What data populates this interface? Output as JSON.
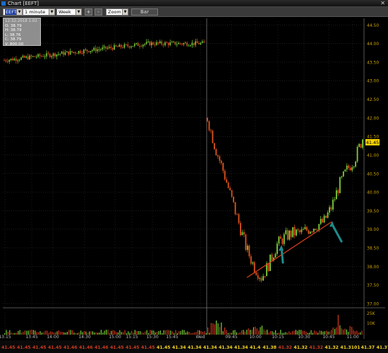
{
  "window": {
    "title": "Chart [EEFT]"
  },
  "toolbar": {
    "symbol": "EEFT",
    "interval": "1 minute",
    "range": "Week",
    "plus_label": "+",
    "minus_label": "-",
    "zoom": "Zoom",
    "bar_label": "Bar"
  },
  "ohlc_box": {
    "header": "12:32:2018 1:02",
    "open": "O: 38.79",
    "high": "H: 38.79",
    "low": "L: 38.76",
    "close": "C: 38.79",
    "volume": "V: 800.00"
  },
  "last_price_tag": "41.45",
  "colors": {
    "background": "#000000",
    "up": "#7fcf3a",
    "down": "#e0541e",
    "axis_label": "#c8a000",
    "grid": "#3a3a3a",
    "trendline": "#d8401a",
    "annotation_arrow": "#1e8c8c",
    "volume": "#cc3a1e"
  },
  "chart_data": {
    "type": "candlestick",
    "symbol": "EEFT",
    "y_axis": {
      "range": [
        37.0,
        44.6
      ],
      "ticks": [
        "44.50",
        "44.00",
        "43.50",
        "43.00",
        "42.50",
        "42.00",
        "41.50",
        "41.00",
        "40.50",
        "40.00",
        "39.50",
        "39.00",
        "38.50",
        "38.00",
        "37.50",
        "37.00"
      ]
    },
    "volume_axis": {
      "ticks": [
        "25K",
        "10K"
      ]
    },
    "x_axis": {
      "ticks": [
        "13:15",
        "13:45",
        "14:00",
        "14:30",
        "15:00",
        "15:15",
        "15:30",
        "15:45",
        "Wed",
        "09:45",
        "10:00",
        "10:15",
        "10:30",
        "10:45",
        "11:00"
      ]
    },
    "session_divider_at": "Wed",
    "prior_session": {
      "level_start": 43.55,
      "level_end": 44.0,
      "close": 43.97
    },
    "current_session": {
      "open": 42.0,
      "low": 37.6,
      "low_time": "10:00",
      "last": 41.45,
      "path": [
        42.0,
        41.2,
        40.6,
        39.9,
        39.2,
        38.5,
        38.0,
        37.7,
        38.1,
        38.6,
        38.8,
        38.9,
        38.9,
        39.0,
        39.1,
        39.2,
        39.6,
        40.2,
        40.6,
        40.9,
        41.45
      ]
    },
    "trendline": {
      "from": {
        "time": "09:58",
        "price": 37.7
      },
      "to": {
        "time": "10:48",
        "price": 39.2
      }
    },
    "annotations": [
      {
        "type": "arrow",
        "at_time": "10:15",
        "price": 38.3
      },
      {
        "type": "arrow",
        "at_time": "10:45",
        "price": 38.9
      }
    ],
    "bottom_strip": {
      "values": [
        "41.45",
        "41.45",
        "41.45",
        "41.45",
        "41.46",
        "41.46",
        "41.46",
        "41.45",
        "41.45",
        "41.45",
        "41.45",
        "41.34",
        "41.34",
        "41.34",
        "41.34",
        "41.34",
        "41.4",
        "41.38",
        "41.32",
        "41.32",
        "41.32",
        "41.32",
        "41.3101",
        "41.37",
        "41.37",
        "41.44",
        "41.45"
      ],
      "up_flags": [
        false,
        false,
        false,
        false,
        false,
        false,
        false,
        false,
        false,
        false,
        true,
        true,
        true,
        true,
        true,
        true,
        true,
        true,
        false,
        true,
        false,
        true,
        true,
        true,
        true,
        true,
        true
      ]
    }
  }
}
